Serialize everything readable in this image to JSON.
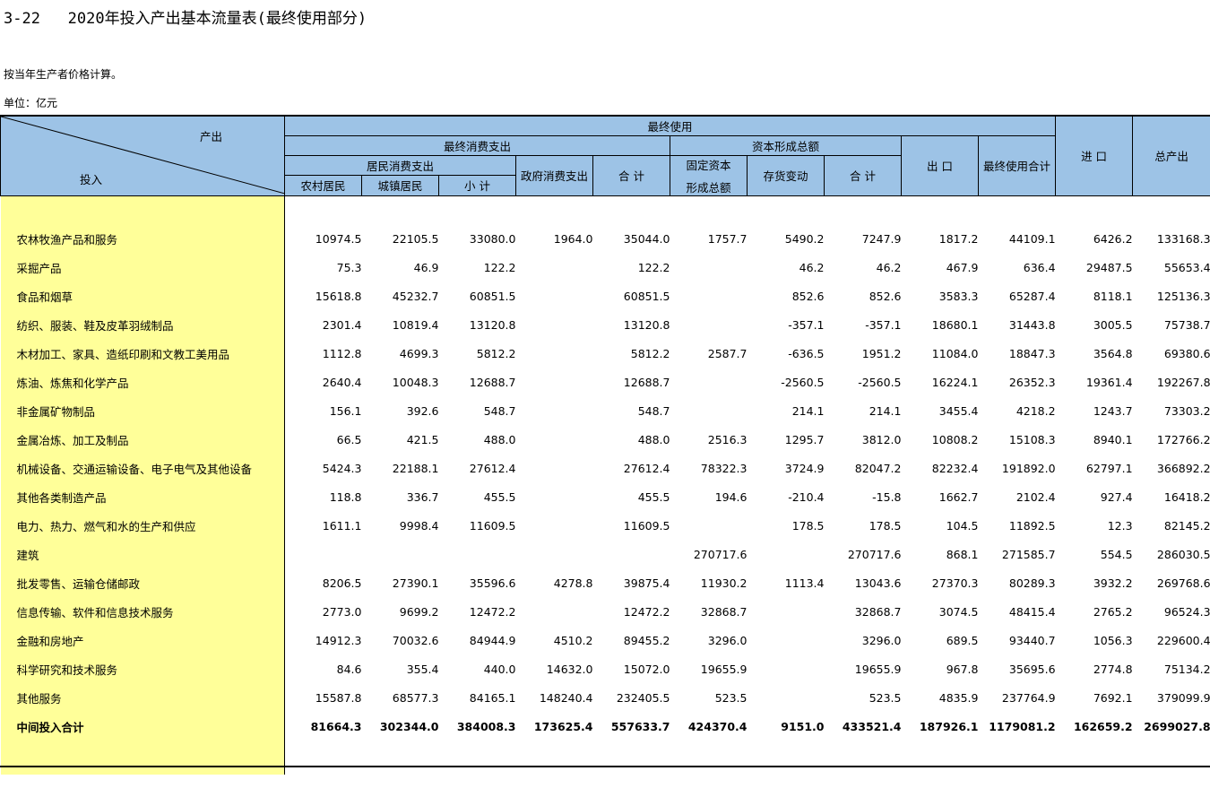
{
  "title": "3-22   2020年投入产出基本流量表(最终使用部分)",
  "note": "按当年生产者价格计算。",
  "unit": "单位：亿元",
  "header": {
    "corner_out": "产出",
    "corner_in": "投入",
    "final_use": "最终使用",
    "final_consumption": "最终消费支出",
    "capital_formation": "资本形成总额",
    "household": "居民消费支出",
    "rural": "农村居民",
    "urban": "城镇居民",
    "subtotal": "小 计",
    "government": "政府消费支出",
    "total_consumption": "合 计",
    "fixed_capital_line1": "固定资本",
    "fixed_capital_line2": "形成总额",
    "inventory": "存货变动",
    "total_capital": "合 计",
    "exports": "出 口",
    "final_use_total": "最终使用合计",
    "imports": "进 口",
    "total_output": "总产出"
  },
  "rows": [
    {
      "label": "农林牧渔产品和服务",
      "v": [
        "10974.5",
        "22105.5",
        "33080.0",
        "1964.0",
        "35044.0",
        "1757.7",
        "5490.2",
        "7247.9",
        "1817.2",
        "44109.1",
        "6426.2",
        "133168.3"
      ]
    },
    {
      "label": "采掘产品",
      "v": [
        "75.3",
        "46.9",
        "122.2",
        "",
        "122.2",
        "",
        "46.2",
        "46.2",
        "467.9",
        "636.4",
        "29487.5",
        "55653.4"
      ]
    },
    {
      "label": "食品和烟草",
      "v": [
        "15618.8",
        "45232.7",
        "60851.5",
        "",
        "60851.5",
        "",
        "852.6",
        "852.6",
        "3583.3",
        "65287.4",
        "8118.1",
        "125136.3"
      ]
    },
    {
      "label": "纺织、服装、鞋及皮革羽绒制品",
      "v": [
        "2301.4",
        "10819.4",
        "13120.8",
        "",
        "13120.8",
        "",
        "-357.1",
        "-357.1",
        "18680.1",
        "31443.8",
        "3005.5",
        "75738.7"
      ]
    },
    {
      "label": "木材加工、家具、造纸印刷和文教工美用品",
      "v": [
        "1112.8",
        "4699.3",
        "5812.2",
        "",
        "5812.2",
        "2587.7",
        "-636.5",
        "1951.2",
        "11084.0",
        "18847.3",
        "3564.8",
        "69380.6"
      ]
    },
    {
      "label": "炼油、炼焦和化学产品",
      "v": [
        "2640.4",
        "10048.3",
        "12688.7",
        "",
        "12688.7",
        "",
        "-2560.5",
        "-2560.5",
        "16224.1",
        "26352.3",
        "19361.4",
        "192267.8"
      ]
    },
    {
      "label": "非金属矿物制品",
      "v": [
        "156.1",
        "392.6",
        "548.7",
        "",
        "548.7",
        "",
        "214.1",
        "214.1",
        "3455.4",
        "4218.2",
        "1243.7",
        "73303.2"
      ]
    },
    {
      "label": "金属冶炼、加工及制品",
      "v": [
        "66.5",
        "421.5",
        "488.0",
        "",
        "488.0",
        "2516.3",
        "1295.7",
        "3812.0",
        "10808.2",
        "15108.3",
        "8940.1",
        "172766.2"
      ]
    },
    {
      "label": "机械设备、交通运输设备、电子电气及其他设备",
      "v": [
        "5424.3",
        "22188.1",
        "27612.4",
        "",
        "27612.4",
        "78322.3",
        "3724.9",
        "82047.2",
        "82232.4",
        "191892.0",
        "62797.1",
        "366892.2"
      ]
    },
    {
      "label": "其他各类制造产品",
      "v": [
        "118.8",
        "336.7",
        "455.5",
        "",
        "455.5",
        "194.6",
        "-210.4",
        "-15.8",
        "1662.7",
        "2102.4",
        "927.4",
        "16418.2"
      ]
    },
    {
      "label": "电力、热力、燃气和水的生产和供应",
      "v": [
        "1611.1",
        "9998.4",
        "11609.5",
        "",
        "11609.5",
        "",
        "178.5",
        "178.5",
        "104.5",
        "11892.5",
        "12.3",
        "82145.2"
      ]
    },
    {
      "label": "建筑",
      "v": [
        "",
        "",
        "",
        "",
        "",
        "270717.6",
        "",
        "270717.6",
        "868.1",
        "271585.7",
        "554.5",
        "286030.5"
      ]
    },
    {
      "label": "批发零售、运输仓储邮政",
      "v": [
        "8206.5",
        "27390.1",
        "35596.6",
        "4278.8",
        "39875.4",
        "11930.2",
        "1113.4",
        "13043.6",
        "27370.3",
        "80289.3",
        "3932.2",
        "269768.6"
      ]
    },
    {
      "label": "信息传输、软件和信息技术服务",
      "v": [
        "2773.0",
        "9699.2",
        "12472.2",
        "",
        "12472.2",
        "32868.7",
        "",
        "32868.7",
        "3074.5",
        "48415.4",
        "2765.2",
        "96524.3"
      ]
    },
    {
      "label": "金融和房地产",
      "v": [
        "14912.3",
        "70032.6",
        "84944.9",
        "4510.2",
        "89455.2",
        "3296.0",
        "",
        "3296.0",
        "689.5",
        "93440.7",
        "1056.3",
        "229600.4"
      ]
    },
    {
      "label": "科学研究和技术服务",
      "v": [
        "84.6",
        "355.4",
        "440.0",
        "14632.0",
        "15072.0",
        "19655.9",
        "",
        "19655.9",
        "967.8",
        "35695.6",
        "2774.8",
        "75134.2"
      ]
    },
    {
      "label": "其他服务",
      "v": [
        "15587.8",
        "68577.3",
        "84165.1",
        "148240.4",
        "232405.5",
        "523.5",
        "",
        "523.5",
        "4835.9",
        "237764.9",
        "7692.1",
        "379099.9"
      ]
    }
  ],
  "total": {
    "label": "中间投入合计",
    "v": [
      "81664.3",
      "302344.0",
      "384008.3",
      "173625.4",
      "557633.7",
      "424370.4",
      "9151.0",
      "433521.4",
      "187926.1",
      "1179081.2",
      "162659.2",
      "2699027.8"
    ]
  }
}
